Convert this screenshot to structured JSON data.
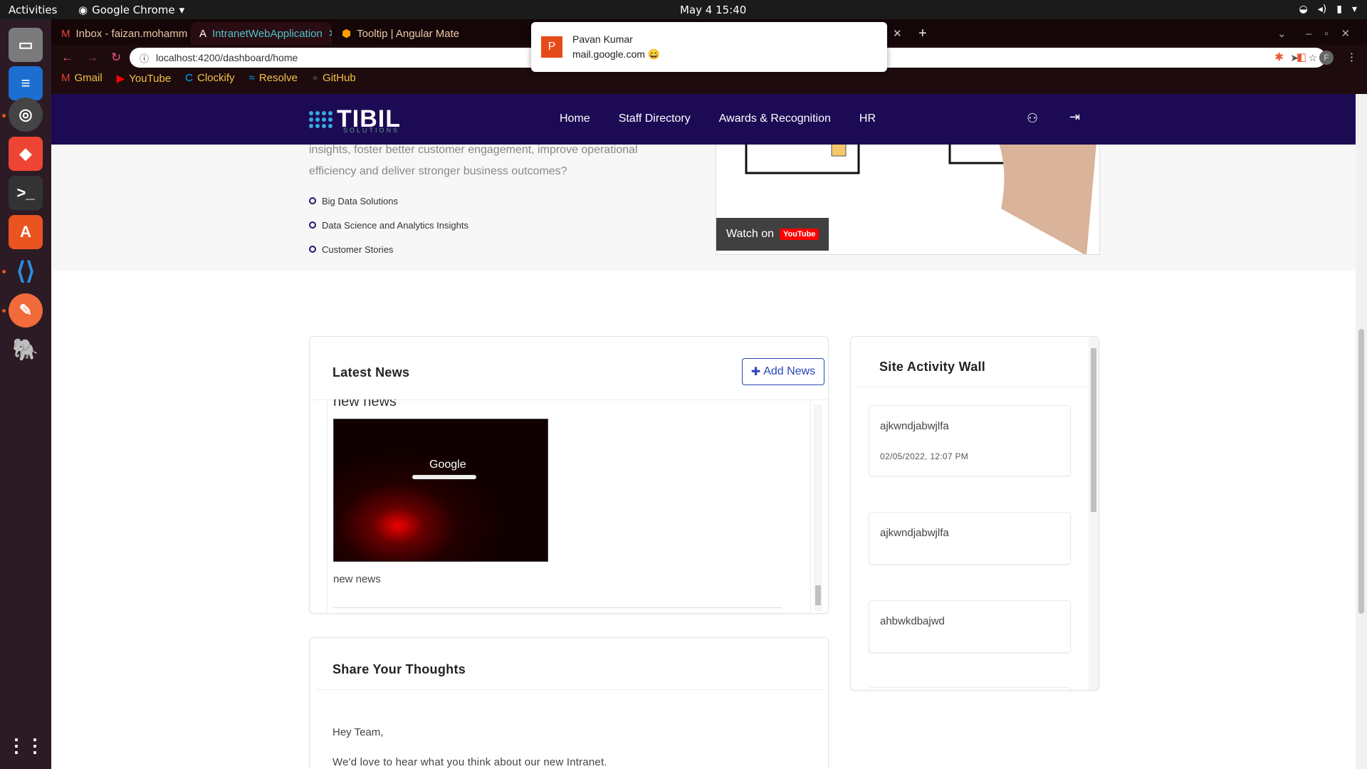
{
  "system": {
    "activities": "Activities",
    "app_name": "Google Chrome",
    "clock": "May 4  15:40"
  },
  "browser": {
    "tabs": [
      {
        "label": "Inbox - faizan.mohamm"
      },
      {
        "label": "IntranetWebApplication"
      },
      {
        "label": "Tooltip | Angular Mate"
      }
    ],
    "url": "localhost:4200/dashboard/home",
    "bookmarks": [
      {
        "label": "Gmail"
      },
      {
        "label": "YouTube"
      },
      {
        "label": "Clockify"
      },
      {
        "label": "Resolve"
      },
      {
        "label": "GitHub"
      }
    ],
    "profile_initial": "F"
  },
  "notification": {
    "avatar": "P",
    "name": "Pavan Kumar",
    "source": "mail.google.com 😄"
  },
  "site": {
    "logo": "TIBIL",
    "logo_sub": "SOLUTIONS",
    "nav": [
      {
        "label": "Home"
      },
      {
        "label": "Staff Directory"
      },
      {
        "label": "Awards & Recognition"
      },
      {
        "label": "HR"
      }
    ]
  },
  "hero": {
    "intro": "insights, foster better customer engagement, improve operational efficiency and deliver stronger business outcomes?",
    "bullets": [
      {
        "label": "Big Data Solutions"
      },
      {
        "label": "Data Science and Analytics Insights"
      },
      {
        "label": "Customer Stories"
      }
    ],
    "video_watch": "Watch on",
    "video_brand": "YouTube"
  },
  "news": {
    "title": "Latest News",
    "add_label": "Add News",
    "item_title": "new news",
    "item_text": "new news",
    "thumb_text": "Google"
  },
  "thoughts": {
    "title": "Share Your Thoughts",
    "p1": "Hey Team,",
    "p2": "We'd love to hear what you think about our new Intranet."
  },
  "wall": {
    "title": "Site Activity Wall",
    "items": [
      {
        "text": "ajkwndjabwjlfa",
        "date": "02/05/2022, 12:07 PM"
      },
      {
        "text": "ajkwndjabwjlfa",
        "date": ""
      },
      {
        "text": "ahbwkdbajwd",
        "date": ""
      }
    ]
  }
}
